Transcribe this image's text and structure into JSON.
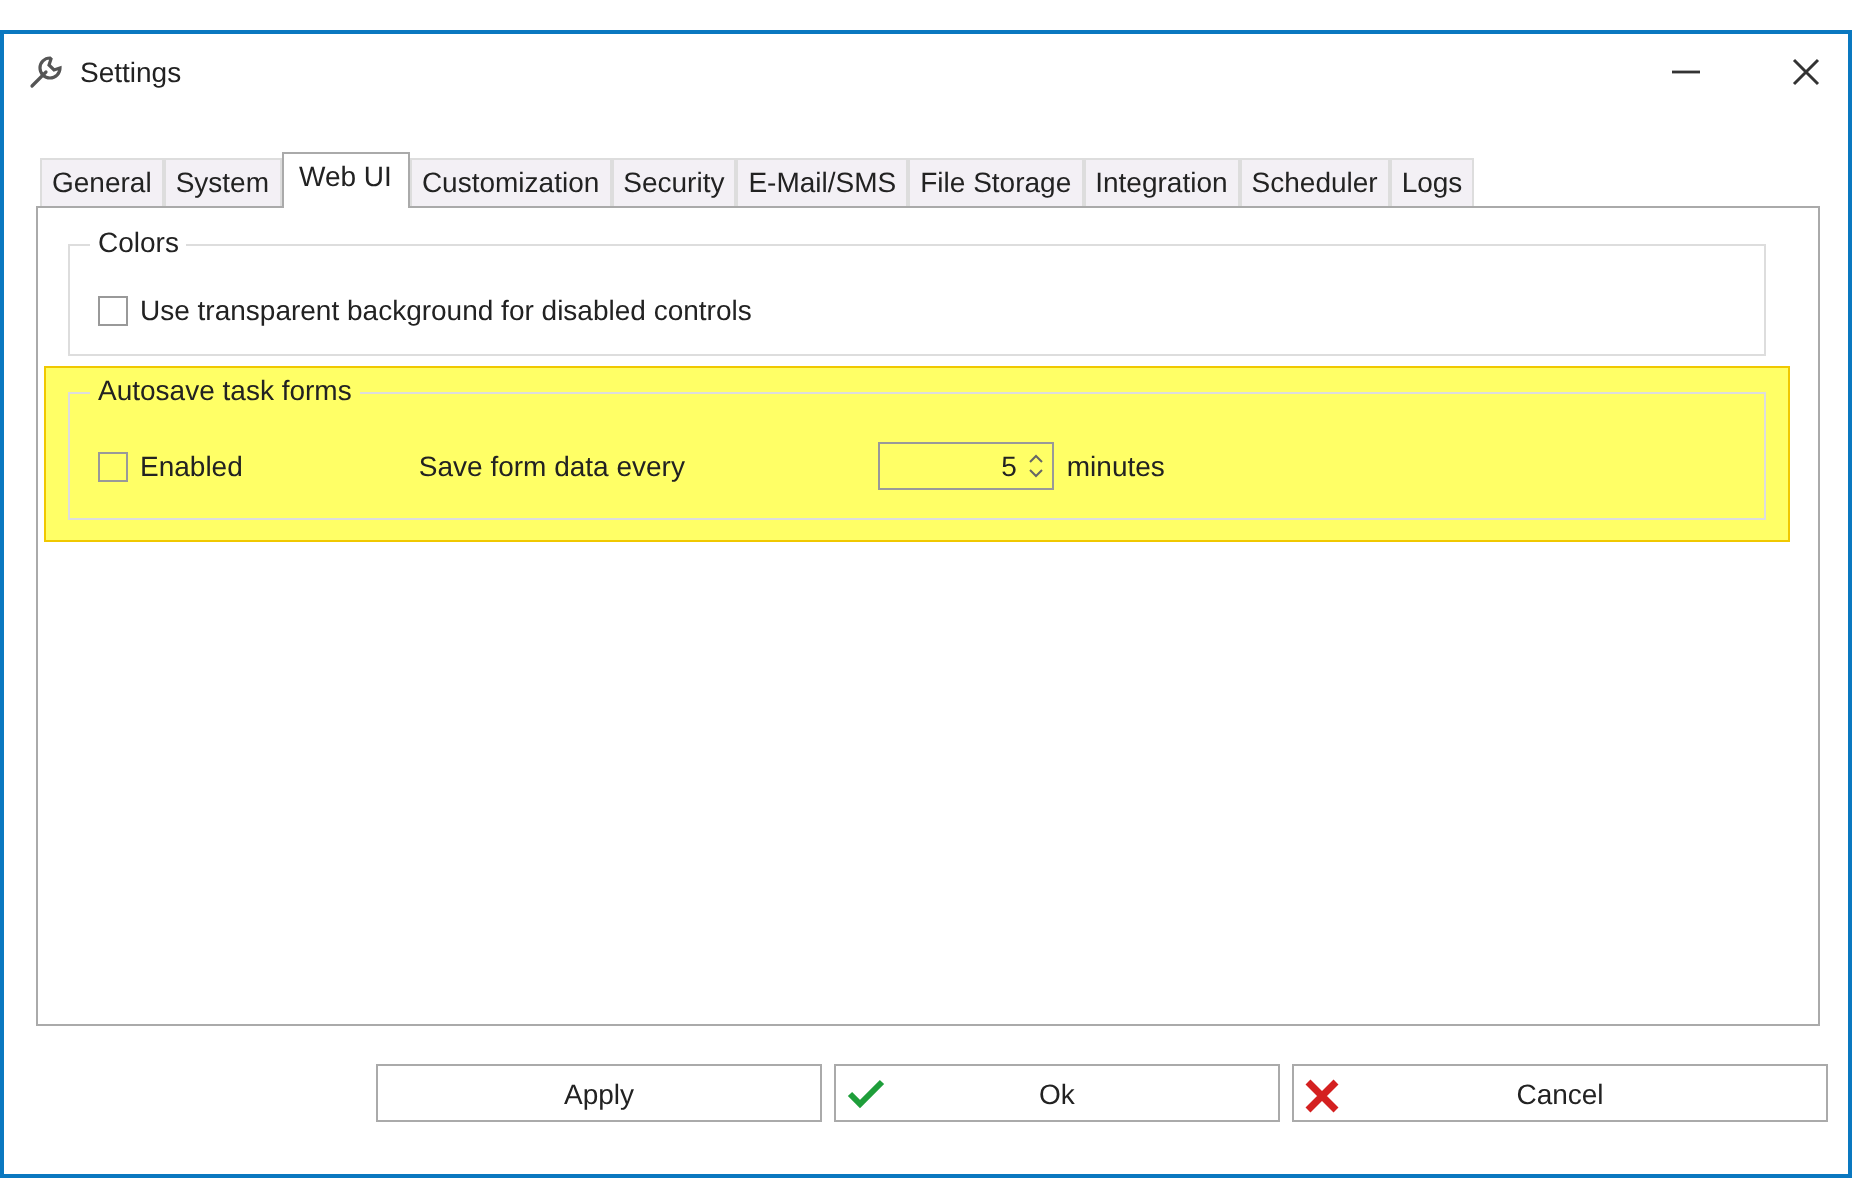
{
  "window": {
    "title": "Settings"
  },
  "tabs": [
    {
      "label": "General",
      "selected": false
    },
    {
      "label": "System",
      "selected": false
    },
    {
      "label": "Web UI",
      "selected": true
    },
    {
      "label": "Customization",
      "selected": false
    },
    {
      "label": "Security",
      "selected": false
    },
    {
      "label": "E-Mail/SMS",
      "selected": false
    },
    {
      "label": "File Storage",
      "selected": false
    },
    {
      "label": "Integration",
      "selected": false
    },
    {
      "label": "Scheduler",
      "selected": false
    },
    {
      "label": "Logs",
      "selected": false
    }
  ],
  "groups": [
    {
      "title": "Colors",
      "highlighted": false,
      "items": [
        {
          "kind": "checkbox",
          "label": "Use transparent background for disabled controls",
          "checked": false
        }
      ]
    },
    {
      "title": "Autosave task forms",
      "highlighted": true,
      "items": [
        {
          "kind": "checkbox",
          "label": "Enabled",
          "checked": false
        },
        {
          "kind": "spinner",
          "label": "Save form data every",
          "value": "5",
          "unit": "minutes"
        }
      ]
    }
  ],
  "buttons": [
    {
      "label": "Apply",
      "kind": "plain"
    },
    {
      "label": "Ok",
      "kind": "confirm"
    },
    {
      "label": "Cancel",
      "kind": "cancel"
    }
  ]
}
